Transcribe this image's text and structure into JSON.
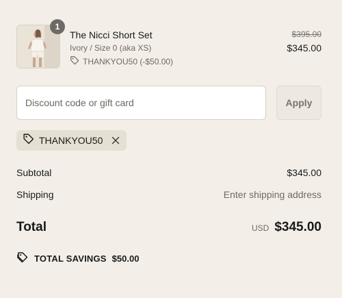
{
  "line_item": {
    "quantity": "1",
    "name": "The Nicci Short Set",
    "variant": "Ivory / Size 0 (aka XS)",
    "discount_applied": "THANKYOU50 (-$50.00)",
    "price_original": "$395.00",
    "price_final": "$345.00",
    "image_icon": "product-photo-woman-in-ivory-short-set"
  },
  "discount": {
    "placeholder": "Discount code or gift card",
    "value": "",
    "apply_label": "Apply"
  },
  "applied_code": {
    "code": "THANKYOU50",
    "tag_icon": "tag-icon",
    "remove_icon": "close-icon"
  },
  "summary": {
    "subtotal_label": "Subtotal",
    "subtotal_value": "$345.00",
    "shipping_label": "Shipping",
    "shipping_value": "Enter shipping address",
    "total_label": "Total",
    "currency": "USD",
    "total_value": "$345.00"
  },
  "savings": {
    "label": "TOTAL SAVINGS",
    "amount": "$50.00",
    "icon": "tags-icon"
  },
  "colors": {
    "background": "#f3efe8",
    "chip_background": "#e6dfd3",
    "badge": "#6e6a66",
    "muted_text": "#6f6a63"
  }
}
